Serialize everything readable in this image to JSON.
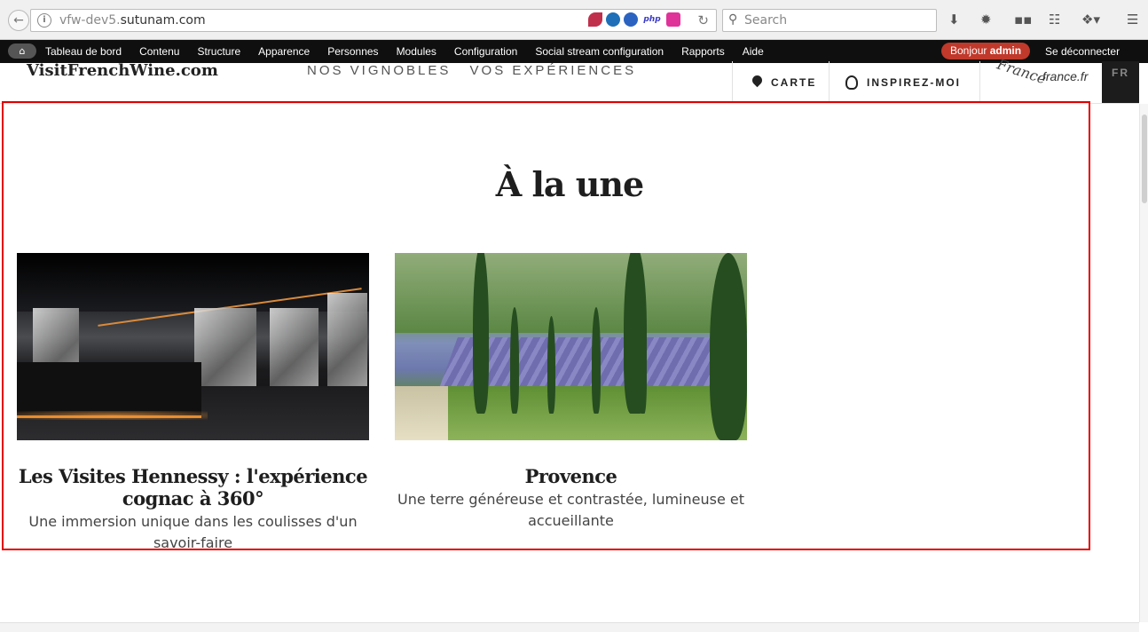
{
  "browser": {
    "url_prefix": "vfw-dev5.",
    "url_domain": "sutunam.com",
    "search_placeholder": "Search",
    "ext_php": "php"
  },
  "admin_toolbar": {
    "items": [
      "Tableau de bord",
      "Contenu",
      "Structure",
      "Apparence",
      "Personnes",
      "Modules",
      "Configuration",
      "Social stream configuration",
      "Rapports",
      "Aide"
    ],
    "greeting": "Bonjour",
    "user": "admin",
    "logout": "Se déconnecter"
  },
  "site_header": {
    "logo": "VisitFrenchWine.com",
    "nav": [
      "NOS VIGNOBLES",
      "VOS EXPÉRIENCES"
    ],
    "carte": "CARTE",
    "inspirez": "INSPIREZ-MOI",
    "francefr_script": "France",
    "francefr": "france.fr",
    "lang": "FR"
  },
  "featured": {
    "title": "À la une",
    "cards": [
      {
        "title": "Les Visites Hennessy : l'expérience cognac à 360°",
        "description": "Une immersion unique dans les coulisses d'un savoir-faire"
      },
      {
        "title": "Provence",
        "description": "Une terre généreuse et contrastée, lumineuse et accueillante"
      }
    ]
  },
  "colors": {
    "focus_frame": "#e00000",
    "admin_bar": "#0f0f0f",
    "greeting_pill": "#c0392b"
  }
}
